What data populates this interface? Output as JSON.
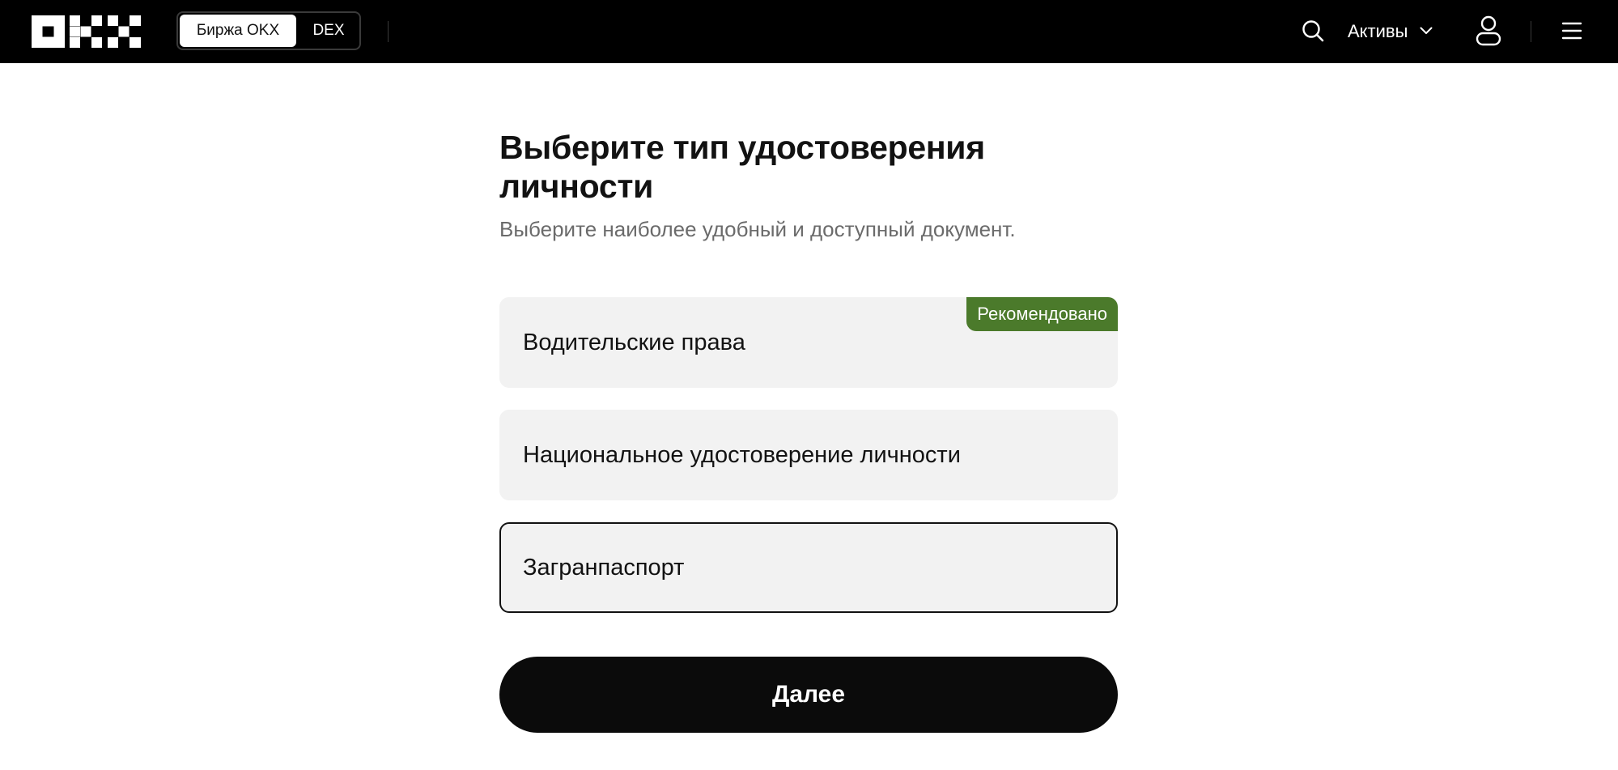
{
  "header": {
    "logo": "OKX",
    "mode_tabs": [
      {
        "label": "Биржа OKX",
        "active": true
      },
      {
        "label": "DEX",
        "active": false
      }
    ],
    "assets_label": "Активы",
    "icons": {
      "search": "search-icon",
      "assets_dropdown": "chevron-down-icon",
      "user": "user-icon",
      "menu": "hamburger-menu-icon"
    }
  },
  "main": {
    "title": "Выберите тип удостоверения личности",
    "subtitle": "Выберите наиболее удобный и доступный документ.",
    "options": [
      {
        "label": "Водительские права",
        "badge": "Рекомендовано",
        "selected": false
      },
      {
        "label": "Национальное удостоверение личности",
        "badge": "",
        "selected": false
      },
      {
        "label": "Загранпаспорт",
        "badge": "",
        "selected": true
      }
    ],
    "next_button": "Далее"
  },
  "colors": {
    "header_bg": "#000000",
    "option_bg": "#f2f2f2",
    "badge_bg": "#4b7a2b",
    "primary_button_bg": "#0b0b0b",
    "text_primary": "#121212",
    "text_secondary": "#6b6b6b"
  }
}
